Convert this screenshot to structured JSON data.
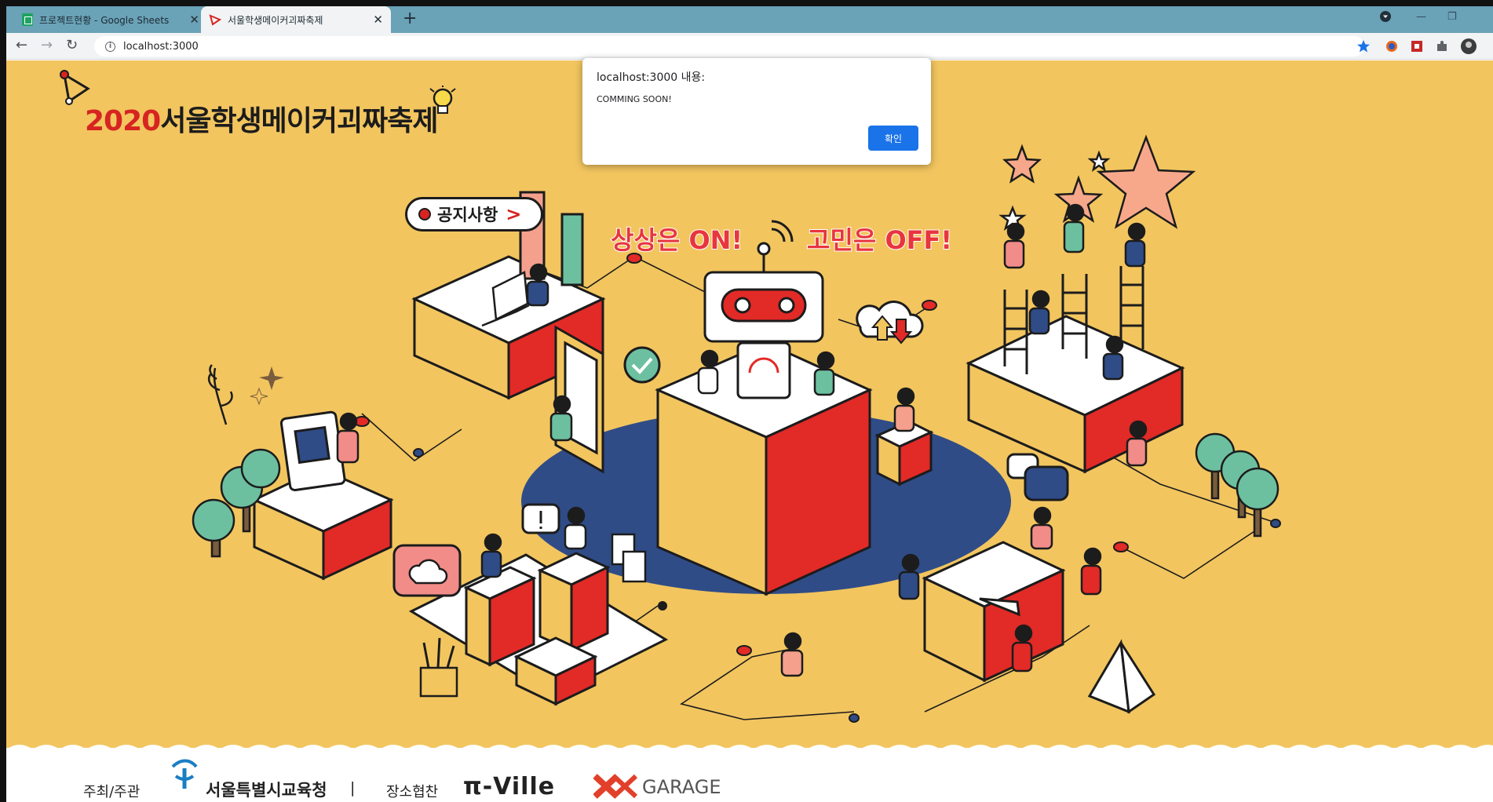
{
  "browser": {
    "tabs": [
      {
        "label": "프로젝트현황 - Google Sheets",
        "active": false
      },
      {
        "label": "서울학생메이커괴짜축제",
        "active": true
      }
    ],
    "url": "localhost:3000"
  },
  "hero": {
    "year": "2020",
    "title": "서울학생메이커괴짜축제",
    "slogan_left": "상상은 ON!",
    "slogan_right": "고민은 OFF!",
    "notice_label": "공지사항"
  },
  "footer": {
    "host_label": "주최/주관",
    "host_org": "서울특별시교육청",
    "separator": "|",
    "venue_label": "장소협찬",
    "sponsor1": "π-Ville",
    "sponsor2": "GARAGE"
  },
  "alert": {
    "title": "localhost:3000 내용:",
    "message": "COMMING SOON!",
    "ok_label": "확인"
  },
  "colors": {
    "background": "#f2c55f",
    "accent_red": "#e22a27",
    "navy": "#2f4c87",
    "mint": "#6cc0a0",
    "dialog_button": "#1a73e8"
  }
}
